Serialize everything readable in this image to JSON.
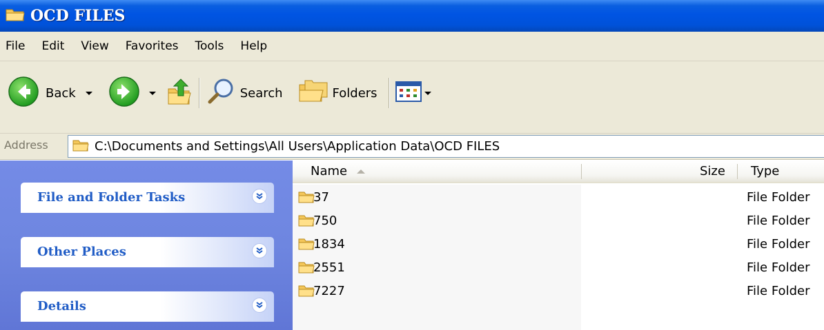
{
  "window": {
    "title": "OCD FILES"
  },
  "menu": [
    "File",
    "Edit",
    "View",
    "Favorites",
    "Tools",
    "Help"
  ],
  "toolbar": {
    "back_label": "Back",
    "search_label": "Search",
    "folders_label": "Folders"
  },
  "address": {
    "label": "Address",
    "value": "C:\\Documents and Settings\\All Users\\Application Data\\OCD FILES"
  },
  "tasks": [
    {
      "label": "File and Folder Tasks"
    },
    {
      "label": "Other Places"
    },
    {
      "label": "Details"
    }
  ],
  "columns": {
    "name": "Name",
    "size": "Size",
    "type": "Type"
  },
  "files": [
    {
      "name": "37",
      "size": "",
      "type": "File Folder"
    },
    {
      "name": "750",
      "size": "",
      "type": "File Folder"
    },
    {
      "name": "1834",
      "size": "",
      "type": "File Folder"
    },
    {
      "name": "2551",
      "size": "",
      "type": "File Folder"
    },
    {
      "name": "7227",
      "size": "",
      "type": "File Folder"
    }
  ],
  "icons": {
    "title": "folder-icon",
    "back": "back-arrow-icon",
    "forward": "forward-arrow-icon",
    "up": "folder-up-icon",
    "search": "magnifier-icon",
    "folders": "folders-icon",
    "views": "views-icon",
    "expand": "chevron-double-down-icon"
  },
  "colors": {
    "titlebar": "#0054e3",
    "taskpane": "#6e86e0",
    "task_title": "#215dc6",
    "folder": "#f5d36a"
  }
}
